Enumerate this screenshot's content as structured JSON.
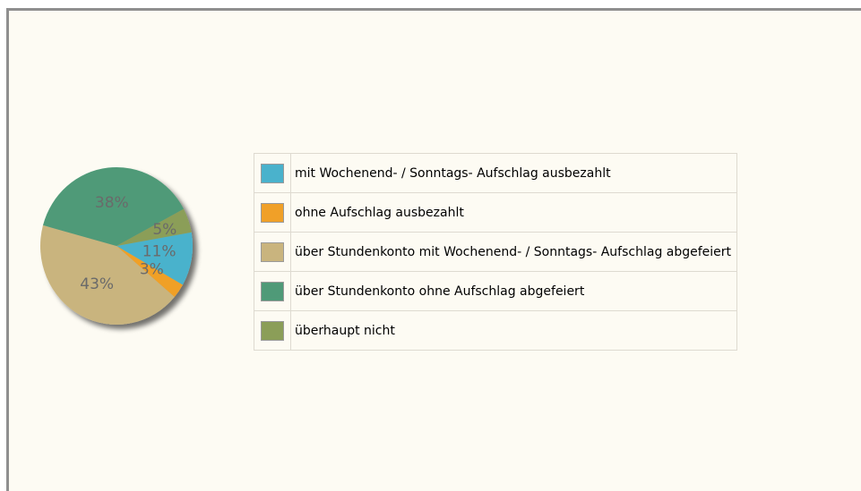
{
  "chart_data": {
    "type": "pie",
    "series": [
      {
        "label": "mit Wochenend- / Sonntags- Aufschlag ausbezahlt",
        "value": 11,
        "value_label": "11%",
        "color": "#4ab2cc"
      },
      {
        "label": "ohne Aufschlag ausbezahlt",
        "value": 3,
        "value_label": "3%",
        "color": "#f0a028"
      },
      {
        "label": "über Stundenkonto mit Wochenend- / Sonntags- Aufschlag abgefeiert",
        "value": 43,
        "value_label": "43%",
        "color": "#c9b47e"
      },
      {
        "label": "über Stundenkonto ohne Aufschlag abgefeiert",
        "value": 38,
        "value_label": "38%",
        "color": "#4f9a78"
      },
      {
        "label": "überhaupt nicht",
        "value": 5,
        "value_label": "5%",
        "color": "#8b9e58"
      }
    ],
    "legend_position": "right"
  }
}
